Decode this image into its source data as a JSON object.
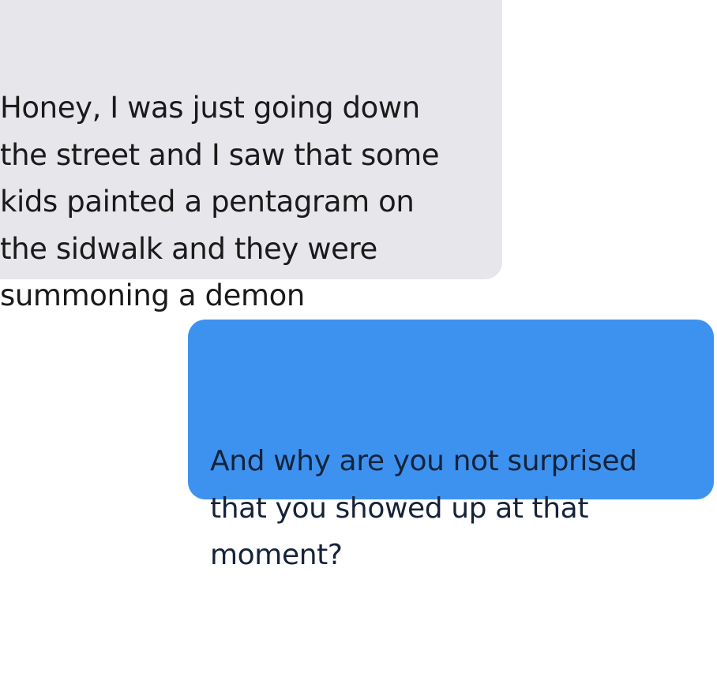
{
  "conversation": {
    "incoming": {
      "text": "Honey, I was just going down\nthe street and I saw that some\nkids painted a pentagram on\nthe sidwalk and they were\nsummoning a demon",
      "color": "#e6e6eb"
    },
    "outgoing": {
      "text": "And why are you not surprised\nthat you showed up at that\nmoment?",
      "color": "#3d92f0"
    }
  }
}
